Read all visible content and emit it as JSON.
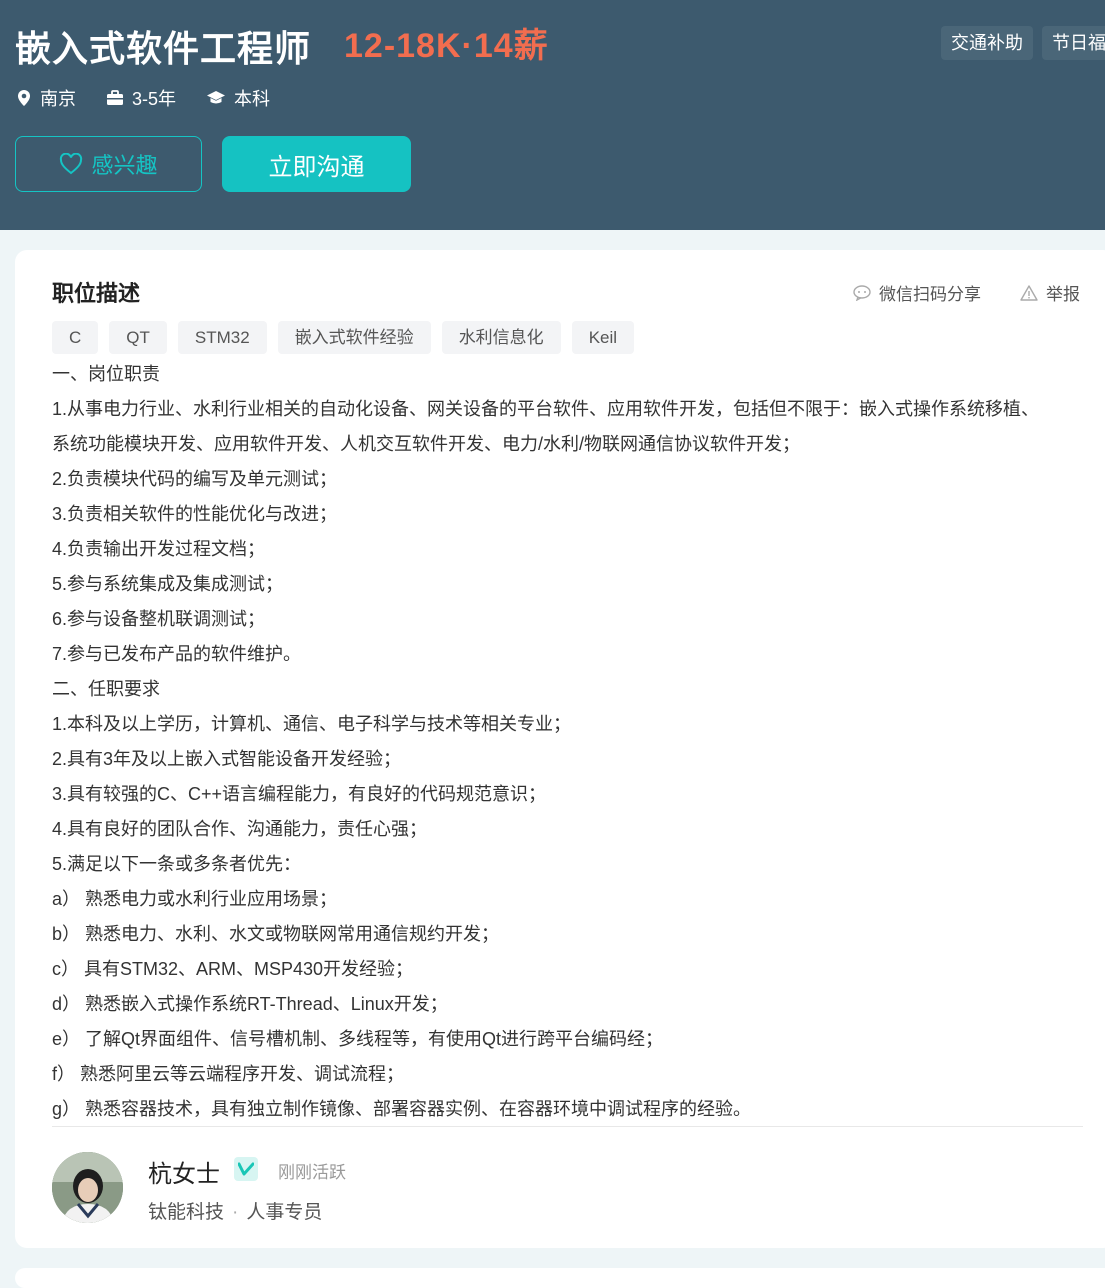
{
  "job": {
    "title": "嵌入式软件工程师",
    "salary": "12-18K·14薪",
    "welfare": [
      "交通补助",
      "节日福"
    ],
    "location": "南京",
    "experience": "3-5年",
    "education": "本科"
  },
  "buttons": {
    "interest_label": "感兴趣",
    "chat_label": "立即沟通"
  },
  "section": {
    "title": "职位描述",
    "share_label": "微信扫码分享",
    "report_label": "举报"
  },
  "tags": [
    "C",
    "QT",
    "STM32",
    "嵌入式软件经验",
    "水利信息化",
    "Keil"
  ],
  "description": [
    "一、岗位职责",
    "1.从事电力行业、水利行业相关的自动化设备、网关设备的平台软件、应用软件开发，包括但不限于：嵌入式操作系统移植、",
    "系统功能模块开发、应用软件开发、人机交互软件开发、电力/水利/物联网通信协议软件开发；",
    "2.负责模块代码的编写及单元测试；",
    "3.负责相关软件的性能优化与改进；",
    "4.负责输出开发过程文档；",
    "5.参与系统集成及集成测试；",
    "6.参与设备整机联调测试；",
    "7.参与已发布产品的软件维护。",
    "二、任职要求",
    "1.本科及以上学历，计算机、通信、电子科学与技术等相关专业；",
    "2.具有3年及以上嵌入式智能设备开发经验；",
    "3.具有较强的C、C++语言编程能力，有良好的代码规范意识；",
    "4.具有良好的团队合作、沟通能力，责任心强；",
    "5.满足以下一条或多条者优先：",
    "a） 熟悉电力或水利行业应用场景；",
    "b） 熟悉电力、水利、水文或物联网常用通信规约开发；",
    "c） 具有STM32、ARM、MSP430开发经验；",
    "d） 熟悉嵌入式操作系统RT-Thread、Linux开发；",
    "e） 了解Qt界面组件、信号槽机制、多线程等，有使用Qt进行跨平台编码经；",
    "f） 熟悉阿里云等云端程序开发、调试流程；",
    "g） 熟悉容器技术，具有独立制作镜像、部署容器实例、在容器环境中调试程序的经验。"
  ],
  "recruiter": {
    "name": "杭女士",
    "status": "刚刚活跃",
    "company": "钛能科技",
    "separator": "·",
    "role": "人事专员"
  },
  "colors": {
    "banner": "#3d5a6e",
    "salary": "#f26d4f",
    "accent": "#15c2c2"
  },
  "icons": [
    "location-icon",
    "briefcase-icon",
    "graduation-cap-icon",
    "heart-icon",
    "wechat-icon",
    "warning-icon",
    "verified-icon"
  ]
}
